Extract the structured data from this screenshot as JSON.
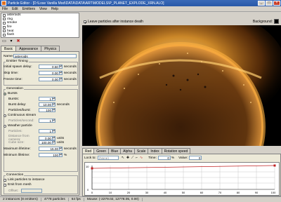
{
  "window": {
    "title": "Particle Editor - [D:\\Lose Vanilla Mod\\DATA\\DATA\\ART\\MODELS\\P_PLANET_EXPLODE_XRN.ALO]",
    "min": "_",
    "max": "□",
    "close": "×"
  },
  "menu": [
    "File",
    "Edit",
    "Emitters",
    "View",
    "Help"
  ],
  "emitters": [
    {
      "label": "asteroids",
      "selected": false
    },
    {
      "label": "ring",
      "selected": false
    },
    {
      "label": "smoke",
      "selected": false
    },
    {
      "label": "fire",
      "selected": false
    },
    {
      "label": "heat",
      "selected": false
    },
    {
      "label": "flash",
      "selected": false
    },
    {
      "label": "smoke",
      "selected": true
    }
  ],
  "list_toolbar": {
    "new_icon": "new-emitter-icon",
    "dropdown": "▾",
    "delete": "✖"
  },
  "left_tabs": [
    "Basic",
    "Appearance",
    "Physics"
  ],
  "basic": {
    "name_label": "Name:",
    "name_value": "asteroids",
    "timing": {
      "group_label": "Emitter Timing",
      "initial_spawn_label": "Initial spawn delay:",
      "initial_spawn_value": "0.50",
      "skip_time_label": "Skip time:",
      "skip_time_value": "0.00",
      "freeze_time_label": "Freeze time:",
      "freeze_time_value": "0.00",
      "unit": "seconds"
    },
    "generation": {
      "group_label": "Generation",
      "bursts_label": "Bursts",
      "bursts_count_label": "Bursts:",
      "bursts_count_value": "1",
      "burst_delay_label": "Burst delay:",
      "burst_delay_value": "10.00",
      "particles_burst_label": "Particles/burst:",
      "particles_burst_value": "100",
      "continuous_label": "Continuous stream",
      "particles_second_label": "Particles/second:",
      "particles_second_value": "1",
      "weather_label": "Weather particle",
      "weather_particles_label": "Particles:",
      "weather_particles_value": "1",
      "distance_label": "Distance from camera:",
      "distance_value": "0.00",
      "distance_unit": "units",
      "cube_label": "Cube size:",
      "cube_value": "100.00",
      "cube_unit": "units",
      "max_lifetime_label": "Maximum lifetime:",
      "max_lifetime_value": "15.00",
      "max_lifetime_unit": "seconds",
      "min_lifetime_label": "Minimum lifetime:",
      "min_lifetime_value": "100",
      "min_lifetime_unit": "%",
      "seconds": "seconds"
    },
    "connection": {
      "group_label": "Connection",
      "link_label": "Link particles to instance",
      "emit_mesh_label": "Emit from mesh",
      "offset_label": "Offset:"
    }
  },
  "viewport": {
    "leave_particles_label": "Leave particles after instance death",
    "background_label": "Background:"
  },
  "curve_tabs": [
    "Red",
    "Green",
    "Blue",
    "Alpha",
    "Scale",
    "Index",
    "Rotation speed"
  ],
  "curve": {
    "lock_to_label": "Lock to:",
    "lock_to_value": "(None)",
    "time_label": "Time:",
    "time_value": "0",
    "value_label": "Value:",
    "value_value": "0",
    "pct": "%",
    "y_ticks": [
      "10",
      "0",
      "0"
    ],
    "x_ticks": [
      "0",
      "10",
      "20",
      "30",
      "40",
      "50",
      "60",
      "70",
      "80",
      "90",
      "100"
    ]
  },
  "status": {
    "instances": "2 instances (8 emitters)",
    "particles": "4778 particles",
    "fps": "64 fps",
    "mouse": "Mouse: (-2279.02, 12778.05, 0.00)"
  }
}
